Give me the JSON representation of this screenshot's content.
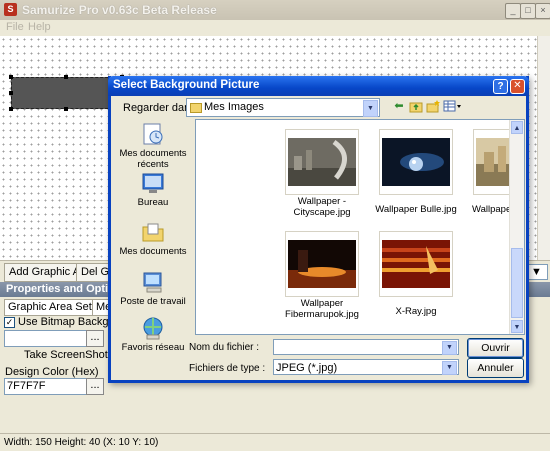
{
  "app": {
    "title": "Samurize Pro v0.63c Beta Release",
    "menu": [
      "File",
      "Help"
    ]
  },
  "toolbar": {
    "add_graphic_area": "Add Graphic Area",
    "del_graphic_area": "Del Gra"
  },
  "properties": {
    "header": "Properties and Optio",
    "tabs": [
      "Graphic Area Settings",
      "Met"
    ],
    "use_bitmap_label": "Use Bitmap Background",
    "use_bitmap_checked": true,
    "bitmap_value": "",
    "browse_label": "...",
    "take_screenshot": "Take ScreenShot",
    "design_color_label": "Design Color (Hex)",
    "design_color_value": "7F7F7F"
  },
  "status": {
    "text": "Width: 150  Height: 40  (X: 10  Y: 10)"
  },
  "dialog": {
    "title": "Select Background Picture",
    "help_glyph": "?",
    "close_glyph": "✕",
    "lookin_label": "Regarder dans :",
    "lookin_value": "Mes Images",
    "places": [
      {
        "label": "Mes documents récents",
        "icon": "recent-documents-icon"
      },
      {
        "label": "Bureau",
        "icon": "desktop-icon"
      },
      {
        "label": "Mes documents",
        "icon": "my-documents-icon"
      },
      {
        "label": "Poste de travail",
        "icon": "my-computer-icon"
      },
      {
        "label": "Favoris réseau",
        "icon": "network-places-icon"
      }
    ],
    "files": [
      {
        "label": "Wallpaper - Cityscape.jpg"
      },
      {
        "label": "Wallpaper Bulle.jpg"
      },
      {
        "label": "Wallpaper City.jpg"
      },
      {
        "label": "Wallpaper Fibermarupok.jpg"
      },
      {
        "label": "X-Ray.jpg"
      }
    ],
    "filename_label": "Nom du fichier :",
    "filename_value": "",
    "filetype_label": "Fichiers de type :",
    "filetype_value": "JPEG (*.jpg)",
    "open_label": "Ouvrir",
    "cancel_label": "Annuler"
  }
}
